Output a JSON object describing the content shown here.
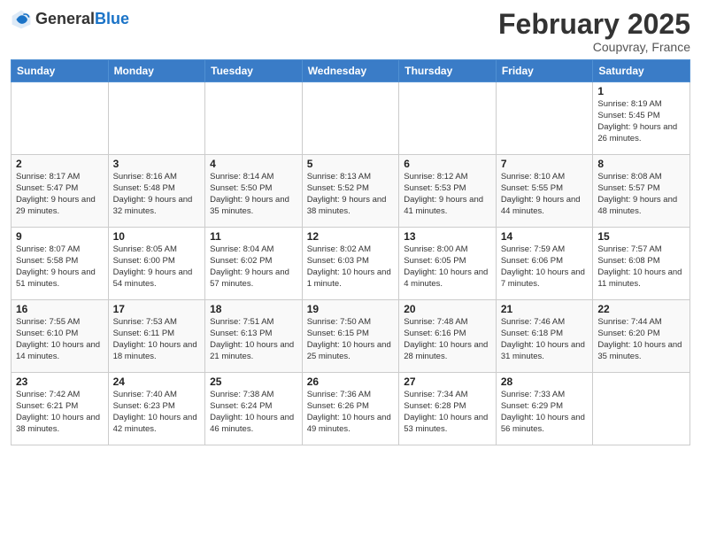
{
  "header": {
    "logo_general": "General",
    "logo_blue": "Blue",
    "month_title": "February 2025",
    "location": "Coupvray, France"
  },
  "weekdays": [
    "Sunday",
    "Monday",
    "Tuesday",
    "Wednesday",
    "Thursday",
    "Friday",
    "Saturday"
  ],
  "weeks": [
    [
      {
        "day": "",
        "info": ""
      },
      {
        "day": "",
        "info": ""
      },
      {
        "day": "",
        "info": ""
      },
      {
        "day": "",
        "info": ""
      },
      {
        "day": "",
        "info": ""
      },
      {
        "day": "",
        "info": ""
      },
      {
        "day": "1",
        "info": "Sunrise: 8:19 AM\nSunset: 5:45 PM\nDaylight: 9 hours and 26 minutes."
      }
    ],
    [
      {
        "day": "2",
        "info": "Sunrise: 8:17 AM\nSunset: 5:47 PM\nDaylight: 9 hours and 29 minutes."
      },
      {
        "day": "3",
        "info": "Sunrise: 8:16 AM\nSunset: 5:48 PM\nDaylight: 9 hours and 32 minutes."
      },
      {
        "day": "4",
        "info": "Sunrise: 8:14 AM\nSunset: 5:50 PM\nDaylight: 9 hours and 35 minutes."
      },
      {
        "day": "5",
        "info": "Sunrise: 8:13 AM\nSunset: 5:52 PM\nDaylight: 9 hours and 38 minutes."
      },
      {
        "day": "6",
        "info": "Sunrise: 8:12 AM\nSunset: 5:53 PM\nDaylight: 9 hours and 41 minutes."
      },
      {
        "day": "7",
        "info": "Sunrise: 8:10 AM\nSunset: 5:55 PM\nDaylight: 9 hours and 44 minutes."
      },
      {
        "day": "8",
        "info": "Sunrise: 8:08 AM\nSunset: 5:57 PM\nDaylight: 9 hours and 48 minutes."
      }
    ],
    [
      {
        "day": "9",
        "info": "Sunrise: 8:07 AM\nSunset: 5:58 PM\nDaylight: 9 hours and 51 minutes."
      },
      {
        "day": "10",
        "info": "Sunrise: 8:05 AM\nSunset: 6:00 PM\nDaylight: 9 hours and 54 minutes."
      },
      {
        "day": "11",
        "info": "Sunrise: 8:04 AM\nSunset: 6:02 PM\nDaylight: 9 hours and 57 minutes."
      },
      {
        "day": "12",
        "info": "Sunrise: 8:02 AM\nSunset: 6:03 PM\nDaylight: 10 hours and 1 minute."
      },
      {
        "day": "13",
        "info": "Sunrise: 8:00 AM\nSunset: 6:05 PM\nDaylight: 10 hours and 4 minutes."
      },
      {
        "day": "14",
        "info": "Sunrise: 7:59 AM\nSunset: 6:06 PM\nDaylight: 10 hours and 7 minutes."
      },
      {
        "day": "15",
        "info": "Sunrise: 7:57 AM\nSunset: 6:08 PM\nDaylight: 10 hours and 11 minutes."
      }
    ],
    [
      {
        "day": "16",
        "info": "Sunrise: 7:55 AM\nSunset: 6:10 PM\nDaylight: 10 hours and 14 minutes."
      },
      {
        "day": "17",
        "info": "Sunrise: 7:53 AM\nSunset: 6:11 PM\nDaylight: 10 hours and 18 minutes."
      },
      {
        "day": "18",
        "info": "Sunrise: 7:51 AM\nSunset: 6:13 PM\nDaylight: 10 hours and 21 minutes."
      },
      {
        "day": "19",
        "info": "Sunrise: 7:50 AM\nSunset: 6:15 PM\nDaylight: 10 hours and 25 minutes."
      },
      {
        "day": "20",
        "info": "Sunrise: 7:48 AM\nSunset: 6:16 PM\nDaylight: 10 hours and 28 minutes."
      },
      {
        "day": "21",
        "info": "Sunrise: 7:46 AM\nSunset: 6:18 PM\nDaylight: 10 hours and 31 minutes."
      },
      {
        "day": "22",
        "info": "Sunrise: 7:44 AM\nSunset: 6:20 PM\nDaylight: 10 hours and 35 minutes."
      }
    ],
    [
      {
        "day": "23",
        "info": "Sunrise: 7:42 AM\nSunset: 6:21 PM\nDaylight: 10 hours and 38 minutes."
      },
      {
        "day": "24",
        "info": "Sunrise: 7:40 AM\nSunset: 6:23 PM\nDaylight: 10 hours and 42 minutes."
      },
      {
        "day": "25",
        "info": "Sunrise: 7:38 AM\nSunset: 6:24 PM\nDaylight: 10 hours and 46 minutes."
      },
      {
        "day": "26",
        "info": "Sunrise: 7:36 AM\nSunset: 6:26 PM\nDaylight: 10 hours and 49 minutes."
      },
      {
        "day": "27",
        "info": "Sunrise: 7:34 AM\nSunset: 6:28 PM\nDaylight: 10 hours and 53 minutes."
      },
      {
        "day": "28",
        "info": "Sunrise: 7:33 AM\nSunset: 6:29 PM\nDaylight: 10 hours and 56 minutes."
      },
      {
        "day": "",
        "info": ""
      }
    ]
  ]
}
